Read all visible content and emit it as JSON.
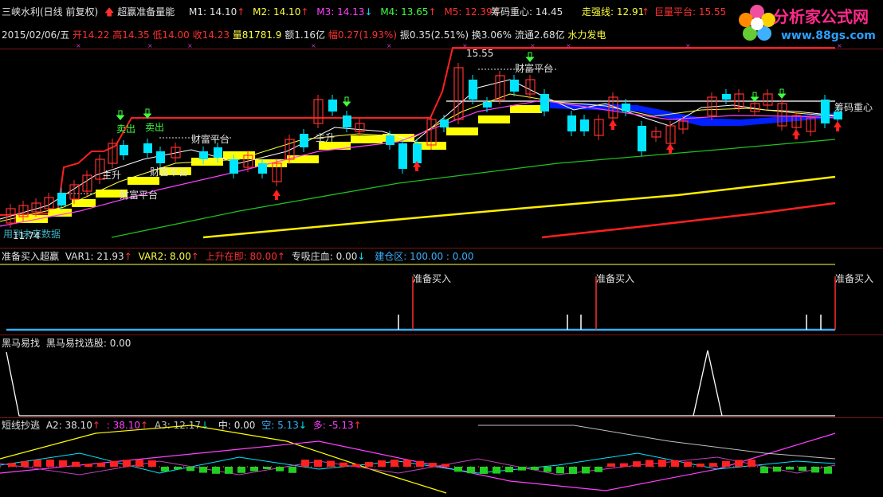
{
  "header": {
    "title": "三峡水利(日线 前复权)",
    "indicator_name": "超赢准备量能",
    "ma_values": [
      {
        "label": "M1: 14.10",
        "color": "#e0e0e0",
        "arrow": "up"
      },
      {
        "label": "M2: 14.10",
        "color": "#ffff40",
        "arrow": "up"
      },
      {
        "label": "M3: 14.13",
        "color": "#ff40ff",
        "arrow": "dn"
      },
      {
        "label": "M4: 13.65",
        "color": "#40ff40",
        "arrow": "up"
      },
      {
        "label": "M5: 12.39",
        "color": "#ff3030",
        "arrow": "up"
      }
    ],
    "chip_center": "筹码重心: 14.45",
    "strong_line": "走强线: 12.91",
    "huge_platform": "巨量平台: 15.55"
  },
  "quote_bar": {
    "date": "2015/02/06/五",
    "open": "开14.22",
    "high": "高14.35",
    "low": "低14.00",
    "close": "收14.23",
    "volume": "量81781.9",
    "amount": "额1.16亿",
    "change": "幅0.27(1.93%)",
    "amplitude": "振0.35(2.51%)",
    "turnover": "换3.06%",
    "float": "流通2.68亿",
    "sector": "水力发电"
  },
  "main_chart": {
    "labels": {
      "top_price": "15.55",
      "chip_center": "筹码重心",
      "bottom_price": "11.74",
      "bottom_text": "用到未来数据",
      "wealth_platform": "财富平台",
      "main_up": "主升",
      "sell": "卖出"
    }
  },
  "panel2": {
    "title": "准备买入超赢",
    "var1": "VAR1: 21.93",
    "var2": "VAR2: 8.00",
    "rising": "上升在即: 80.00",
    "absorb": "专吸庄血: 0.00",
    "build": "建仓区: 100.00 : 0.00",
    "signal_label": "准备买入"
  },
  "panel3": {
    "title": "黑马易找",
    "value": "黑马易找选股: 0.00"
  },
  "panel4": {
    "title": "短线抄逃",
    "a2": "A2: 38.10",
    "a2b": ": 38.10",
    "a3": "A3: 12.17",
    "mid": "中: 0.00",
    "empty": "空: 5.13",
    "more": "多: -5.13"
  },
  "logo": {
    "brand": "分析家公式网",
    "url": "www.88gs.com"
  },
  "colors": {
    "up": "#ff3030",
    "down": "#00e5ff",
    "yellow": "#ffff00",
    "magenta": "#ff40ff",
    "green": "#20c020",
    "frame": "#7a1515"
  }
}
